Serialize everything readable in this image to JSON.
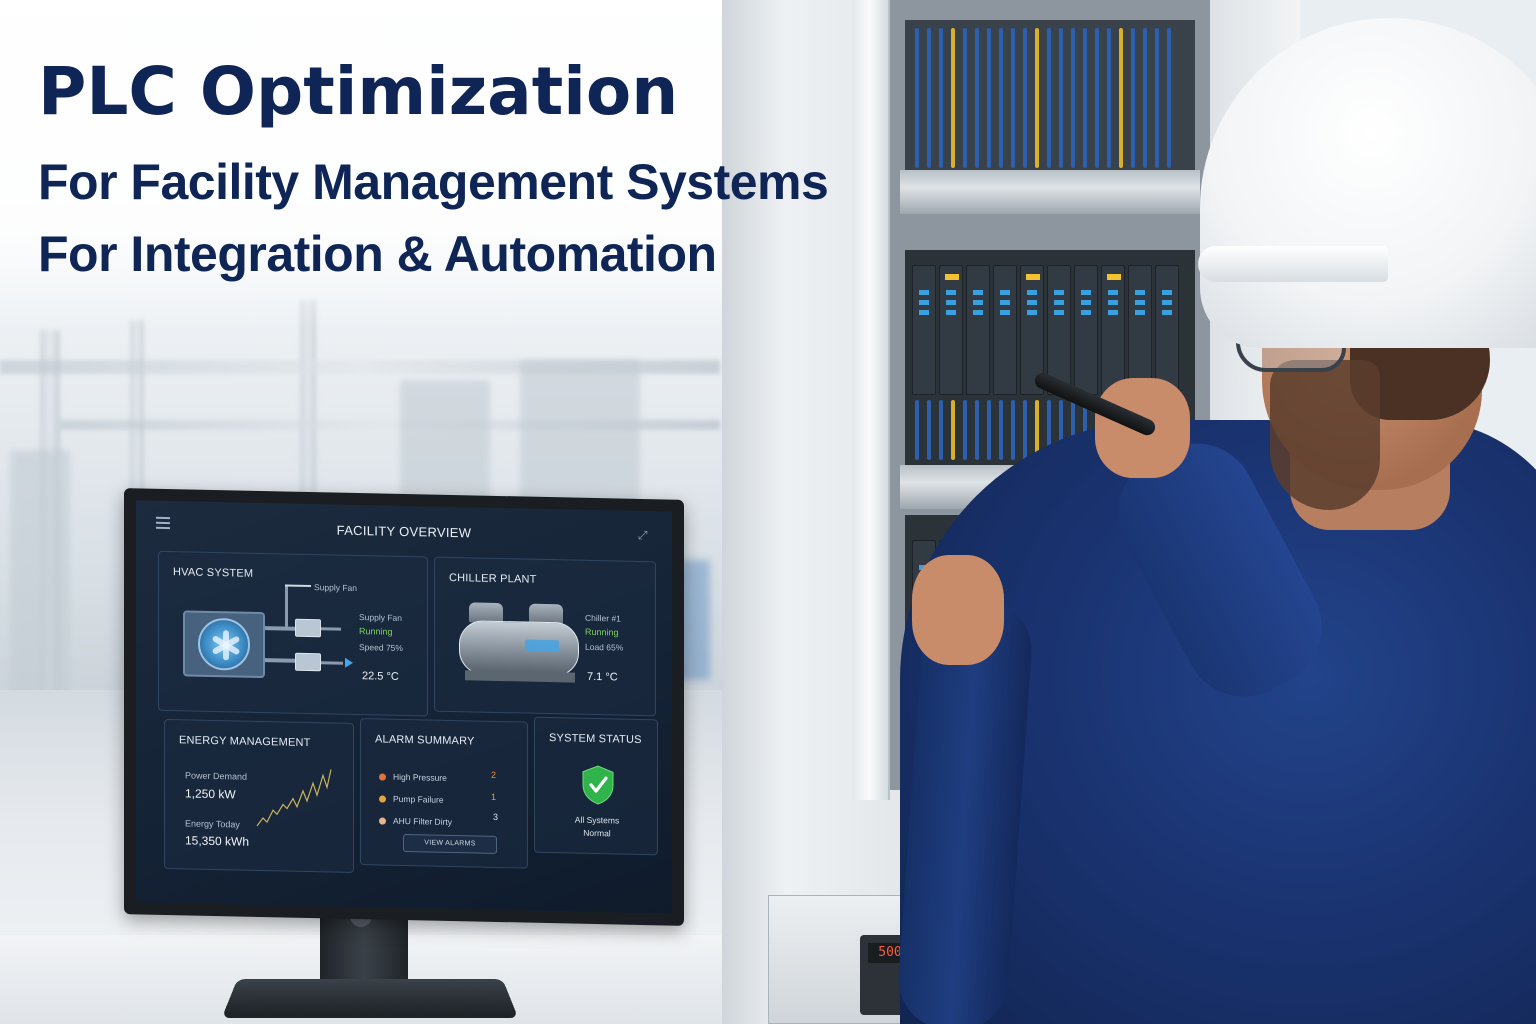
{
  "headline": {
    "title": "PLC Optimization",
    "line1": "For Facility Management Systems",
    "line2": "For Integration & Automation"
  },
  "dashboard": {
    "title": "FACILITY OVERVIEW",
    "menu_icon": "hamburger-menu-icon",
    "expand_icon": "expand-icon",
    "hvac": {
      "title": "HVAC SYSTEM",
      "supply_fan_callout": "Supply Fan",
      "status_label": "Supply Fan",
      "status": "Running",
      "speed": "Speed 75%",
      "temperature": "22.5 °C"
    },
    "chiller": {
      "title": "CHILLER PLANT",
      "unit": "Chiller #1",
      "status": "Running",
      "load": "Load 65%",
      "temperature": "7.1 °C"
    },
    "energy": {
      "title": "ENERGY MANAGEMENT",
      "power_label": "Power Demand",
      "power_value": "1,250 kW",
      "energy_label": "Energy Today",
      "energy_value": "15,350 kWh"
    },
    "alarms": {
      "title": "ALARM SUMMARY",
      "items": [
        {
          "label": "High Pressure",
          "count": "2",
          "color": "#e0743a"
        },
        {
          "label": "Pump Failure",
          "count": "1",
          "color": "#e5a53b"
        },
        {
          "label": "AHU Filter Dirty",
          "count": "3",
          "color": "#e8b48e"
        }
      ],
      "button": "VIEW ALARMS"
    },
    "system_status": {
      "title": "SYSTEM STATUS",
      "icon": "check-shield-icon",
      "line1": "All Systems",
      "line2": "Normal"
    }
  },
  "vfd": {
    "display": "500"
  },
  "colors": {
    "headline": "#0e2556",
    "running": "#7ecf5a",
    "status_green": "#2fb34a"
  }
}
